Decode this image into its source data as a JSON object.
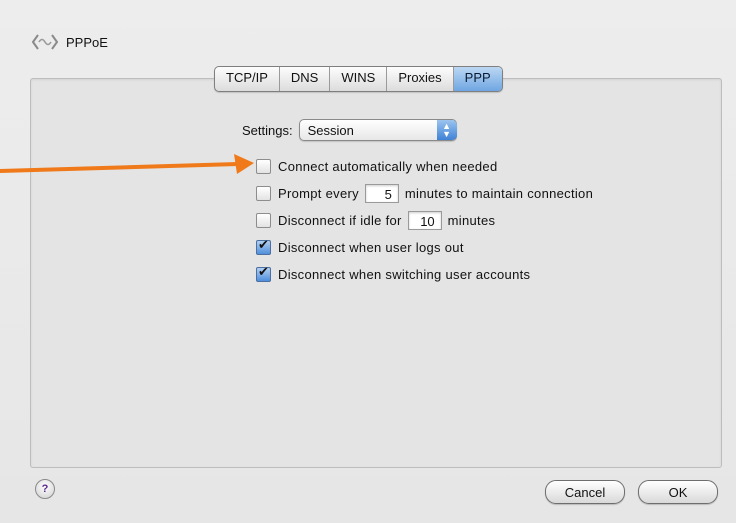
{
  "header": {
    "title": "PPPoE",
    "icon": "network-icon"
  },
  "tabs": [
    {
      "label": "TCP/IP",
      "selected": false
    },
    {
      "label": "DNS",
      "selected": false
    },
    {
      "label": "WINS",
      "selected": false
    },
    {
      "label": "Proxies",
      "selected": false
    },
    {
      "label": "PPP",
      "selected": true
    }
  ],
  "settings": {
    "label": "Settings:",
    "selected_value": "Session"
  },
  "options": [
    {
      "label": "Connect automatically when needed",
      "checked": false
    },
    {
      "prefix": "Prompt every",
      "value": "5",
      "suffix": "minutes to maintain connection",
      "checked": false
    },
    {
      "prefix": "Disconnect if idle for",
      "value": "10",
      "suffix": "minutes",
      "checked": false
    },
    {
      "label": "Disconnect when user logs out",
      "checked": true
    },
    {
      "label": "Disconnect when switching user accounts",
      "checked": true
    }
  ],
  "annotation": {
    "arrow_color": "#f07a1a"
  },
  "footer": {
    "help_icon": "?",
    "cancel_label": "Cancel",
    "ok_label": "OK"
  },
  "colors": {
    "tab_selected": "#6fa6e2",
    "checkbox_checked": "#4f8fdc",
    "arrow": "#f07a1a"
  }
}
